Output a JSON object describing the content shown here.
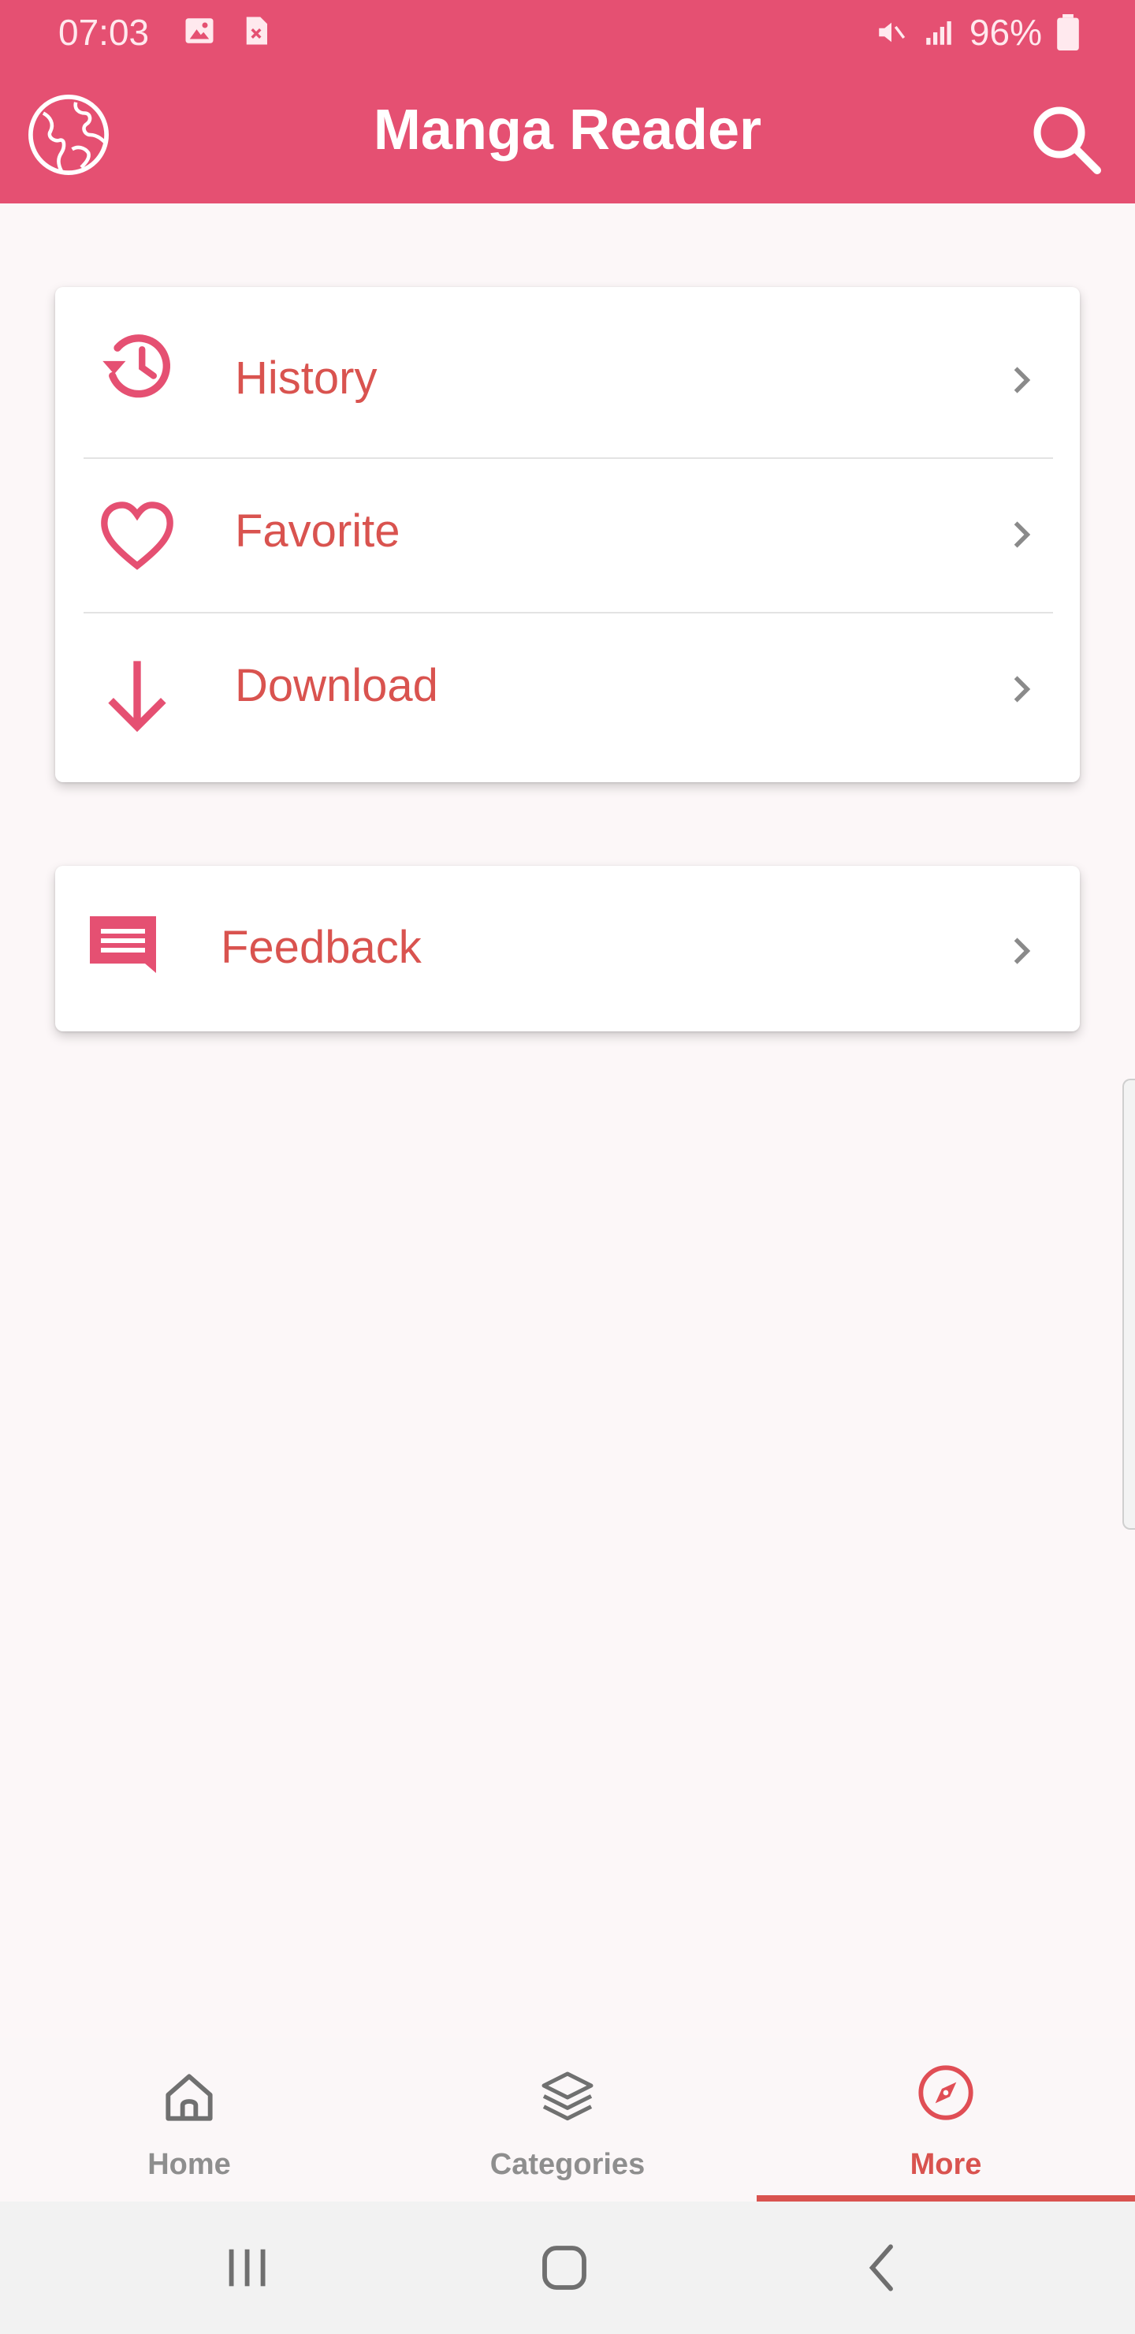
{
  "status_bar": {
    "time": "07:03",
    "battery": "96%"
  },
  "app_bar": {
    "title": "Manga Reader"
  },
  "menu": {
    "items": [
      {
        "label": "History",
        "icon": "history-icon"
      },
      {
        "label": "Favorite",
        "icon": "heart-icon"
      },
      {
        "label": "Download",
        "icon": "download-icon"
      }
    ],
    "feedback": {
      "label": "Feedback",
      "icon": "feedback-icon"
    }
  },
  "bottom_nav": {
    "items": [
      {
        "label": "Home",
        "icon": "home-icon",
        "active": false
      },
      {
        "label": "Categories",
        "icon": "layers-icon",
        "active": false
      },
      {
        "label": "More",
        "icon": "compass-icon",
        "active": true
      }
    ]
  },
  "colors": {
    "primary": "#e55072",
    "accent_text": "#d9534f",
    "background": "#fcf7f8"
  }
}
